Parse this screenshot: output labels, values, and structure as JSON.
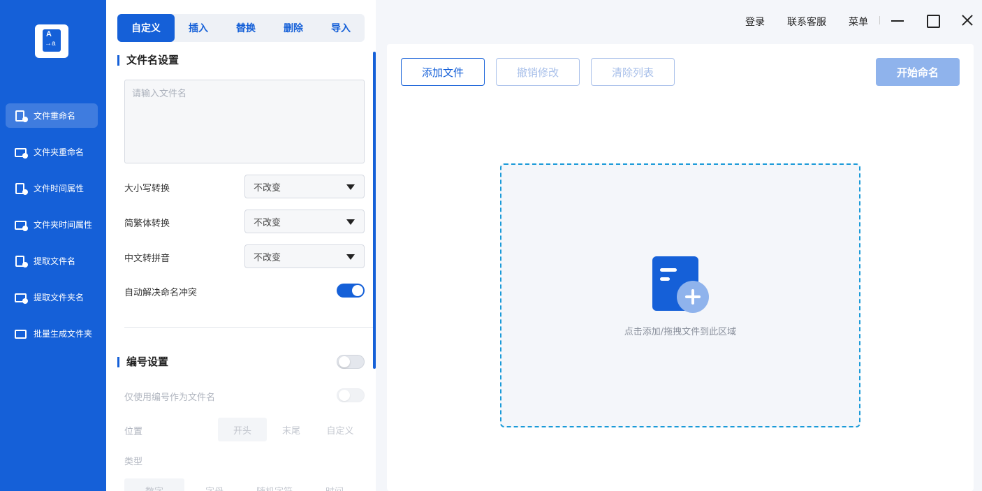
{
  "sidebar": {
    "items": [
      {
        "label": "文件重命名",
        "icon": "file-edit-icon",
        "active": true
      },
      {
        "label": "文件夹重命名",
        "icon": "folder-edit-icon"
      },
      {
        "label": "文件时间属性",
        "icon": "file-clock-icon"
      },
      {
        "label": "文件夹时间属性",
        "icon": "folder-clock-icon"
      },
      {
        "label": "提取文件名",
        "icon": "file-extract-icon"
      },
      {
        "label": "提取文件夹名",
        "icon": "folder-extract-icon"
      },
      {
        "label": "批量生成文件夹",
        "icon": "folders-batch-icon"
      }
    ]
  },
  "tabs": [
    {
      "label": "自定义",
      "active": true
    },
    {
      "label": "插入"
    },
    {
      "label": "替换"
    },
    {
      "label": "删除"
    },
    {
      "label": "导入"
    }
  ],
  "filename_settings": {
    "title": "文件名设置",
    "placeholder": "请输入文件名",
    "value": "",
    "case_label": "大小写转换",
    "case_value": "不改变",
    "trad_label": "简繁体转换",
    "trad_value": "不改变",
    "pinyin_label": "中文转拼音",
    "pinyin_value": "不改变",
    "conflict_label": "自动解决命名冲突",
    "conflict_on": true
  },
  "numbering": {
    "title": "编号设置",
    "enabled": false,
    "only_number_label": "仅使用编号作为文件名",
    "position_label": "位置",
    "positions": [
      "开头",
      "末尾",
      "自定义"
    ],
    "type_label": "类型",
    "types": [
      "数字",
      "字母",
      "随机字符",
      "时间"
    ]
  },
  "topbar": {
    "login": "登录",
    "support": "联系客服",
    "menu": "菜单"
  },
  "toolbar": {
    "add_files": "添加文件",
    "undo": "撤销修改",
    "clear": "清除列表",
    "start": "开始命名"
  },
  "dropzone": {
    "hint": "点击添加/拖拽文件到此区域"
  },
  "colors": {
    "brand": "#1560d8",
    "dashed_border": "#1a9ad8",
    "disabled": "#8fb3ec"
  }
}
